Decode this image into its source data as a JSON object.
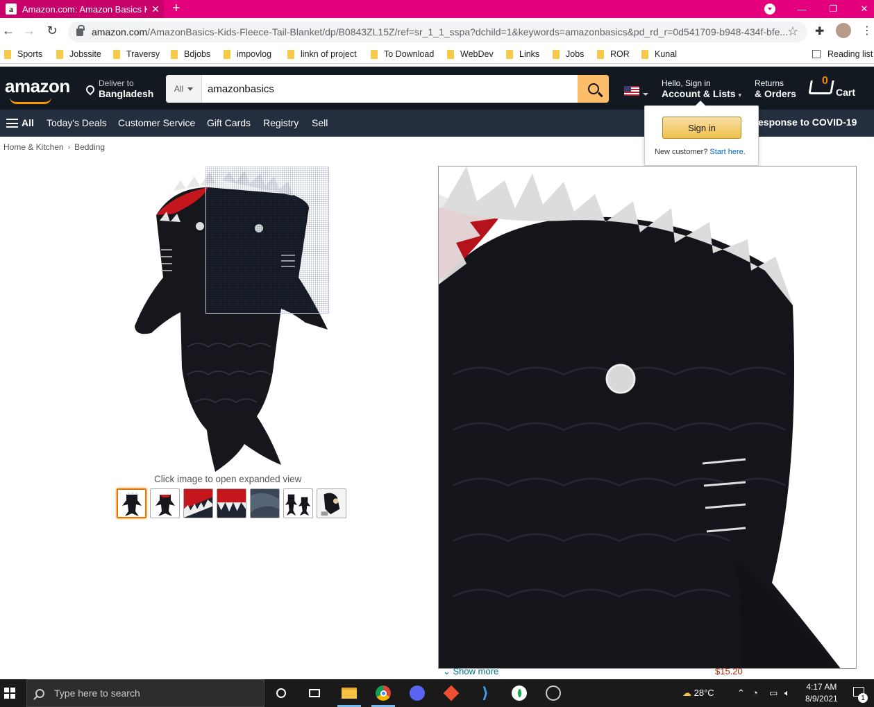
{
  "browser": {
    "tab_title": "Amazon.com: Amazon Basics Kid",
    "tab_favicon": "a",
    "new_tab_glyph": "+",
    "url_host": "amazon.com",
    "url_path": "/AmazonBasics-Kids-Fleece-Tail-Blanket/dp/B0843ZL15Z/ref=sr_1_1_sspa?dchild=1&keywords=amazonbasics&pd_rd_r=0d541709-b948-434f-bfe...",
    "bookmarks": [
      "Sports",
      "Jobssite",
      "Traversy",
      "Bdjobs",
      "impovlog",
      "linkn of project",
      "To Download",
      "WebDev",
      "Links",
      "Jobs",
      "ROR",
      "Kunal"
    ],
    "reading_list": "Reading list",
    "accent_color": "#e4007c"
  },
  "amazon": {
    "logo": "amazon",
    "deliver_line1": "Deliver to",
    "deliver_line2": "Bangladesh",
    "search_category": "All",
    "search_value": "amazonbasics",
    "account_line1": "Hello, Sign in",
    "account_line2": "Account & Lists",
    "returns_line1": "Returns",
    "returns_line2": "& Orders",
    "cart_count": "0",
    "cart_label": "Cart",
    "nav": {
      "all": "All",
      "items": [
        "Today's Deals",
        "Customer Service",
        "Gift Cards",
        "Registry",
        "Sell"
      ],
      "covid": "esponse to COVID-19"
    },
    "flyout": {
      "signin": "Sign in",
      "new_customer": "New customer?",
      "start_here": "Start here."
    },
    "breadcrumb": [
      "Home & Kitchen",
      "Bedding"
    ],
    "caption": "Click image to open expanded view",
    "thumb_count": 7,
    "show_more": "Show more",
    "price_partial": "$15.20"
  },
  "taskbar": {
    "search_placeholder": "Type here to search",
    "weather": "28°C",
    "time": "4:17 AM",
    "date": "8/9/2021",
    "notifications": "1"
  }
}
